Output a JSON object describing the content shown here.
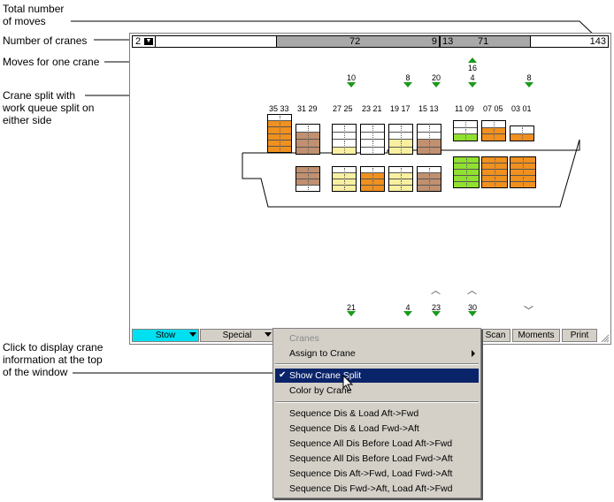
{
  "annotations": {
    "total_moves": "Total number\nof moves",
    "num_cranes": "Number of cranes",
    "moves_one_crane": "Moves for one crane",
    "crane_split": "Crane split with\nwork queue split on\neither side",
    "click_display": "Click to display crane\ninformation at the top\nof the window"
  },
  "crane_bar": {
    "num_cranes": "2",
    "crane1_moves": "72",
    "crane1_split": "9",
    "crane2_split": "13",
    "crane2_moves": "71",
    "total_moves": "143"
  },
  "top_moves": [
    {
      "label": "10",
      "bay": "27 25"
    },
    {
      "label": "8",
      "bay": "19 17"
    },
    {
      "label": "20",
      "bay": "15 13"
    },
    {
      "label": "16",
      "bay": "11 09 up"
    },
    {
      "label": "4",
      "bay": "11 09"
    },
    {
      "label": "8",
      "bay": "03 01"
    }
  ],
  "bottom_moves": [
    {
      "label": "21"
    },
    {
      "label": "4"
    },
    {
      "label": "23"
    },
    {
      "label": "30"
    }
  ],
  "bays": [
    "35 33",
    "31 29",
    "27 25",
    "23 21",
    "19 17",
    "15 13",
    "11 09",
    "07 05",
    "03 01"
  ],
  "colors": {
    "orange": "#f0901e",
    "brown": "#c09070",
    "yellow": "#f8f0a0",
    "green": "#90e030",
    "cyan": "#00e0f0",
    "menu_highlight": "#0a246a",
    "arrow_green": "#1a9a1a"
  },
  "toolbar": {
    "stow": "Stow",
    "special": "Special",
    "scan": "Scan",
    "moments": "Moments",
    "print": "Print"
  },
  "menu": {
    "header": "Cranes",
    "assign": "Assign to Crane",
    "show_split": "Show Crane Split",
    "color_by": "Color by Crane",
    "seq1": "Sequence Dis & Load Aft->Fwd",
    "seq2": "Sequence Dis & Load Fwd->Aft",
    "seq3": "Sequence All Dis Before Load Aft->Fwd",
    "seq4": "Sequence All Dis Before Load Fwd->Aft",
    "seq5": "Sequence Dis Aft->Fwd, Load Fwd->Aft",
    "seq6": "Sequence Dis Fwd->Aft, Load Aft->Fwd"
  }
}
